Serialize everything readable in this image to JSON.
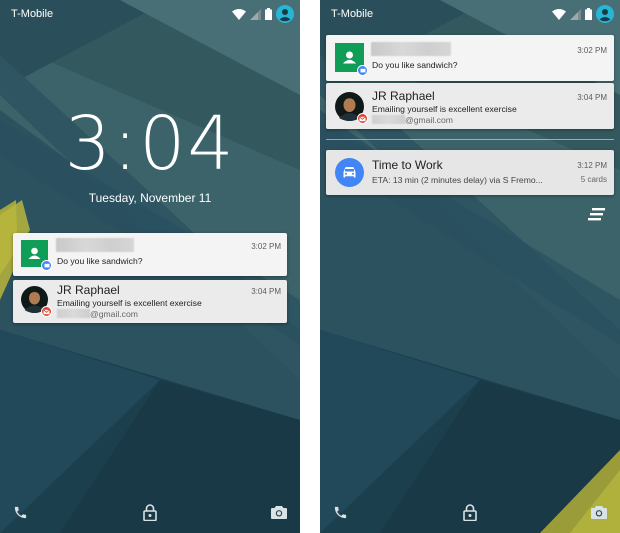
{
  "left_phone": {
    "carrier": "T-Mobile",
    "clock": "3:04",
    "date": "Tuesday, November 11",
    "notifications": [
      {
        "app": "hangouts",
        "title": "",
        "time": "3:02 PM",
        "body": "Do you like sandwich?"
      },
      {
        "app": "gmail",
        "title": "JR Raphael",
        "time": "3:04 PM",
        "body": "Emailing yourself is excellent exercise",
        "sub_suffix": "@gmail.com"
      }
    ]
  },
  "right_phone": {
    "carrier": "T-Mobile",
    "notifications": [
      {
        "app": "hangouts",
        "title": "",
        "time": "3:02 PM",
        "body": "Do you like sandwich?"
      },
      {
        "app": "gmail",
        "title": "JR Raphael",
        "time": "3:04 PM",
        "body": "Emailing yourself is excellent exercise",
        "sub_suffix": "@gmail.com"
      },
      {
        "app": "google-now",
        "title": "Time to Work",
        "time": "3:12 PM",
        "body": "ETA: 13 min (2 minutes delay) via S Fremo...",
        "meta": "5 cards"
      }
    ]
  },
  "icons": {
    "status": [
      "wifi-icon",
      "signal-icon",
      "battery-icon",
      "user-avatar-icon"
    ],
    "bottom": [
      "phone-icon",
      "lock-icon",
      "camera-icon"
    ],
    "clear_all": "clear-all-icon"
  },
  "colors": {
    "wallpaper_dark": "#234b58",
    "wallpaper_mid": "#37606b",
    "wallpaper_light": "#4b7a80",
    "accent_yellow": "#b4b33a",
    "hangouts_green": "#0f9d58",
    "gmail_red": "#db4437",
    "google_now_blue": "#4285f4",
    "avatar_teal": "#26b6d8"
  }
}
